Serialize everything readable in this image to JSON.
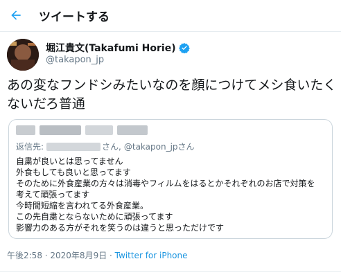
{
  "header": {
    "title": "ツイートする",
    "back_icon": "arrow-left-icon"
  },
  "colors": {
    "accent": "#1da1f2",
    "link": "#1b95e0",
    "muted": "#657786",
    "text": "#14171a",
    "border": "#e6ecf0"
  },
  "author": {
    "display_name": "堀江貴文(Takafumi Horie)",
    "handle": "@takapon_jp",
    "verified_icon": "verified-badge-icon"
  },
  "tweet": {
    "text": "あの変なフンドシみたいなのを顔につけてメシ食いたくないだろ普通",
    "timestamp": "午後2:58 · 2020年8月9日",
    "separator": " · ",
    "source": "Twitter for iPhone"
  },
  "quote": {
    "reply_prefix": "返信先:",
    "reply_suffix": "さん,",
    "reply_mention": "@takapon_jpさん",
    "lines": [
      "自粛が良いとは思ってません",
      "外食もしても良いと思ってます",
      "そのために外食産業の方々は消毒やフィルムをはるとかそれぞれのお店で対策を",
      "考えて頑張ってます",
      "今時間短縮を言われてる外食産業。",
      "この先自粛とならないために頑張ってます",
      "影響力のある方がそれを笑うのは違うと思っただけです"
    ]
  }
}
